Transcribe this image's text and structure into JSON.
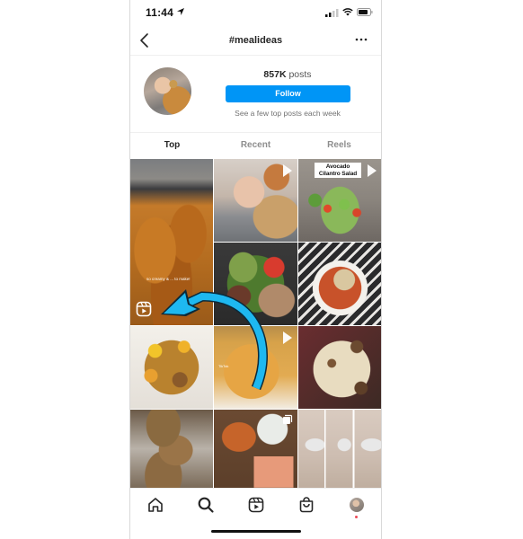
{
  "status_bar": {
    "time": "11:44",
    "icons": [
      "location-arrow-icon",
      "cellular-signal-icon",
      "wifi-icon",
      "battery-icon"
    ]
  },
  "header": {
    "title": "#mealideas",
    "back_icon": "chevron-left-icon",
    "more_icon": "ellipsis-icon"
  },
  "hashtag_info": {
    "posts_count": "857K",
    "posts_label": "posts",
    "follow_label": "Follow",
    "subtitle": "See a few top posts each week"
  },
  "tabs": [
    {
      "label": "Top",
      "active": true
    },
    {
      "label": "Recent",
      "active": false
    },
    {
      "label": "Reels",
      "active": false
    }
  ],
  "grid": {
    "tiles": [
      {
        "description": "Creamy curry dish in pan",
        "type": "reel",
        "overlay_text": "so creamy & ... to make!"
      },
      {
        "description": "Woman holding food in front of face",
        "type": "video"
      },
      {
        "description": "Avocado cilantro salad in glass bowl",
        "type": "video",
        "label": "Avocado Cilantro Salad"
      },
      {
        "description": "Salad with grilled chicken, avocado, tomatoes",
        "type": "photo"
      },
      {
        "description": "Tomato soup with mushrooms",
        "type": "photo"
      },
      {
        "description": "Sweet potato hash with tofu",
        "type": "photo"
      },
      {
        "description": "Baked golden dish (TikTok)",
        "type": "video",
        "watermark": "TikTok"
      },
      {
        "description": "Chicken with mushrooms in cream sauce skillet",
        "type": "photo"
      },
      {
        "description": "Stuffed chicken breasts with asparagus",
        "type": "photo"
      },
      {
        "description": "Groceries: carrots, cauliflower, chicken",
        "type": "carousel"
      },
      {
        "description": "Couple pregnancy progression photos",
        "type": "photo"
      }
    ]
  },
  "annotation": {
    "arrow_color": "#1eb8f0",
    "arrow_target": "reels-icon-on-first-tile"
  },
  "bottom_nav": {
    "items": [
      "home-icon",
      "search-icon",
      "reels-icon",
      "shop-icon",
      "profile-avatar"
    ],
    "active": "search-icon",
    "notification_dot_color": "#ed4956"
  },
  "colors": {
    "follow_button": "#0095f6",
    "text_primary": "#262626",
    "text_secondary": "#8e8e8e"
  }
}
